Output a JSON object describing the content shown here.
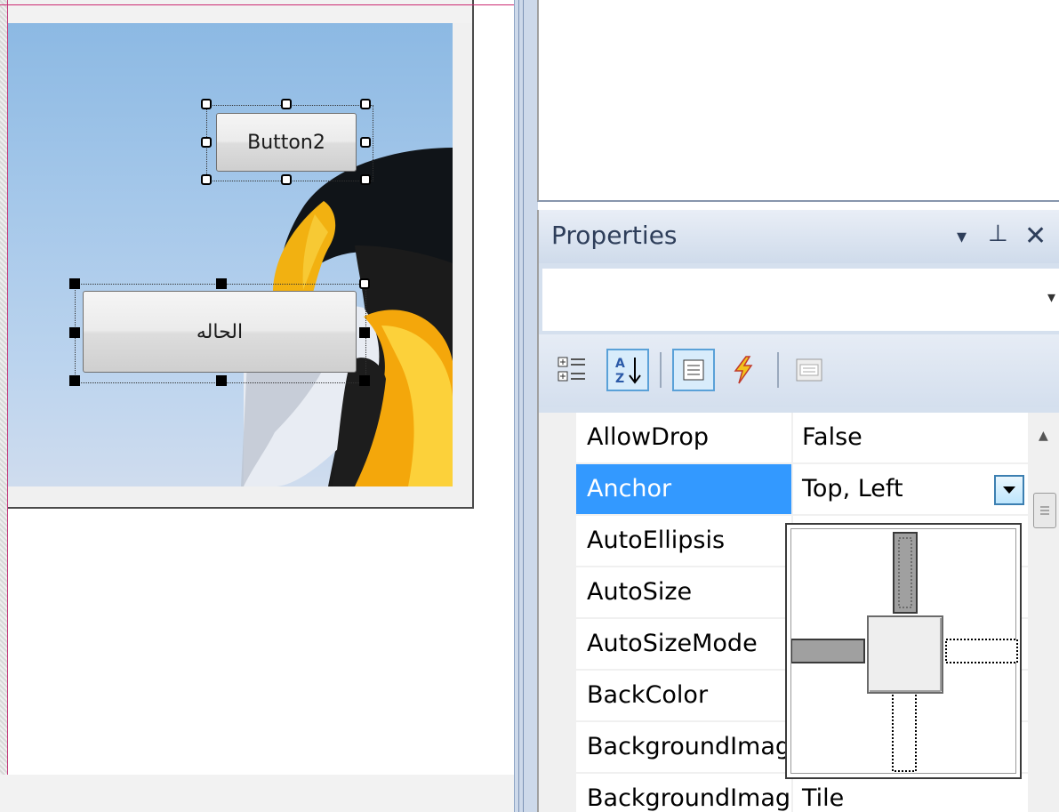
{
  "designer": {
    "button2_label": "Button2",
    "button1_label": "الحاله"
  },
  "properties": {
    "title": "Properties",
    "header_icons": {
      "dropdown": "▾",
      "pin": "⊥",
      "close": "✕"
    },
    "object_selector_value": "",
    "toolbar": {
      "categorized": "categorized-icon",
      "alphabetical": "alphabetical-icon",
      "properties": "properties-icon",
      "events": "events-icon",
      "property_pages": "property-pages-icon"
    },
    "rows": [
      {
        "name": "AllowDrop",
        "value": "False"
      },
      {
        "name": "Anchor",
        "value": "Top, Left"
      },
      {
        "name": "AutoEllipsis",
        "value": ""
      },
      {
        "name": "AutoSize",
        "value": ""
      },
      {
        "name": "AutoSizeMode",
        "value": ""
      },
      {
        "name": "BackColor",
        "value": ""
      },
      {
        "name": "BackgroundImage",
        "value": ""
      },
      {
        "name": "BackgroundImageLayout",
        "value": "Tile"
      }
    ],
    "selected_row": "Anchor",
    "anchor_editor": {
      "top": true,
      "left": true,
      "right": false,
      "bottom": false
    }
  },
  "colors": {
    "selection": "#3399ff",
    "panel_header": "#cfdbeb",
    "anchor_on": "#a0a0a0"
  }
}
